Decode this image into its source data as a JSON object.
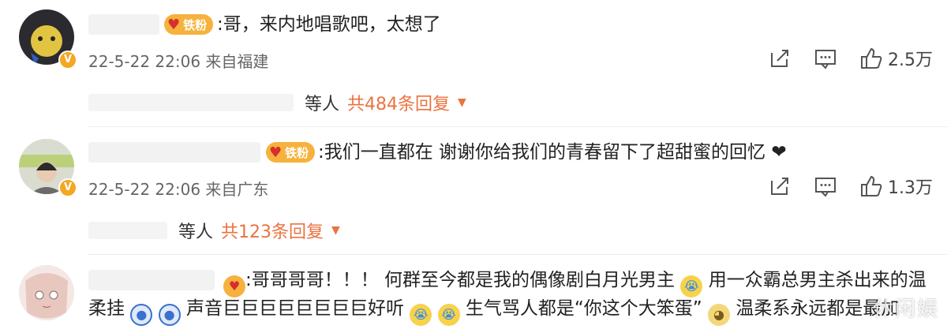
{
  "comments": [
    {
      "text": "哥，来内地唱歌吧，太想了",
      "timestamp": "22-5-22 22:06",
      "location": "来自福建",
      "fan_badge": "铁粉",
      "likes": "2.5万",
      "replies_who": "等人",
      "replies_count": "共484条回复"
    },
    {
      "text": "我们一直都在 谢谢你给我们的青春留下了超甜蜜的回忆 ❤",
      "timestamp": "22-5-22 22:06",
      "location": "来自广东",
      "fan_badge": "铁粉",
      "likes": "1.3万",
      "replies_who": "等人",
      "replies_count": "共123条回复"
    },
    {
      "line1_a": "哥哥哥哥！！！ 何群至今都是我的偶像剧白月光男主",
      "line1_b": "用一众霸总男主杀出来的温",
      "line2_a": "柔挂",
      "line2_b": "声音巨巨巨巨巨巨巨巨好听",
      "line2_c": "生气骂人都是“你这个大笨蛋”",
      "line2_d": "温柔系永远都是最加"
    }
  ],
  "icons": {
    "share": "share-icon",
    "comment": "comment-icon",
    "like": "thumbs-up-icon"
  },
  "colors": {
    "accent": "#eb7340",
    "badge": "#f6b23c",
    "verified": "#f5a623"
  },
  "watermark": "休闲娱"
}
